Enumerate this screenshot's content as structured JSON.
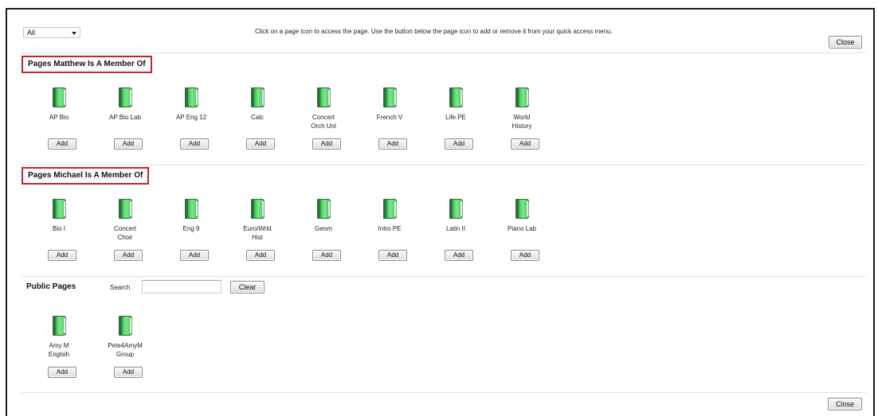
{
  "filter": {
    "selected": "All"
  },
  "instructions": "Click on a page icon to access the page. Use the button below the page icon to add or remove it from your quick access menu.",
  "close_label": "Close",
  "add_label": "Add",
  "icon_name": "book-icon",
  "sections": {
    "matthew": {
      "title": "Pages Matthew Is A Member Of",
      "pages": [
        "AP Bio",
        "AP Bio Lab",
        "AP Eng 12",
        "Calc",
        "Concert\nOrch Unl",
        "French V",
        "Life PE",
        "World\nHistory"
      ]
    },
    "michael": {
      "title": "Pages Michael Is A Member Of",
      "pages": [
        "Bio I",
        "Concert\nChoir",
        "Eng 9",
        "Euro/Wrld\nHist",
        "Geom",
        "Intro PE",
        "Latin II",
        "Piano Lab"
      ]
    },
    "public": {
      "title": "Public Pages",
      "search_label": "Search",
      "search_value": "",
      "clear_label": "Clear",
      "pages": [
        "Amy M\nEnglsih",
        "Pete4AmyM\nGroup"
      ]
    }
  },
  "colors": {
    "highlight_border": "#c0272d",
    "book_green": "#4cbf5e"
  }
}
